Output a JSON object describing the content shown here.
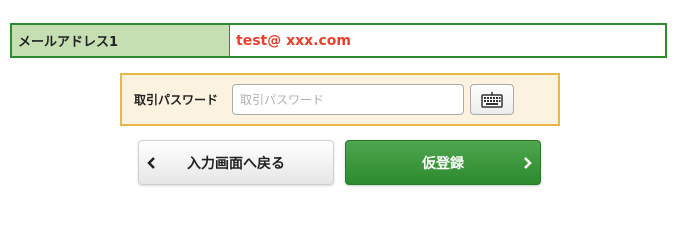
{
  "email_row": {
    "label": "メールアドレス1",
    "value": "test@ xxx.com"
  },
  "password_section": {
    "label": "取引パスワード",
    "placeholder": "取引パスワード",
    "value": "",
    "keyboard_icon": "keyboard-icon"
  },
  "buttons": {
    "back_label": "入力画面へ戻る",
    "back_icon": "chevron-left-icon",
    "submit_label": "仮登録",
    "submit_icon": "chevron-right-icon"
  },
  "colors": {
    "green_border": "#2d8a2d",
    "label_bg": "#c5dfb2",
    "email_text": "#e8402a",
    "pw_border": "#e8b84d",
    "pw_bg": "#fbf3e0",
    "submit_bg": "#3c983c"
  }
}
